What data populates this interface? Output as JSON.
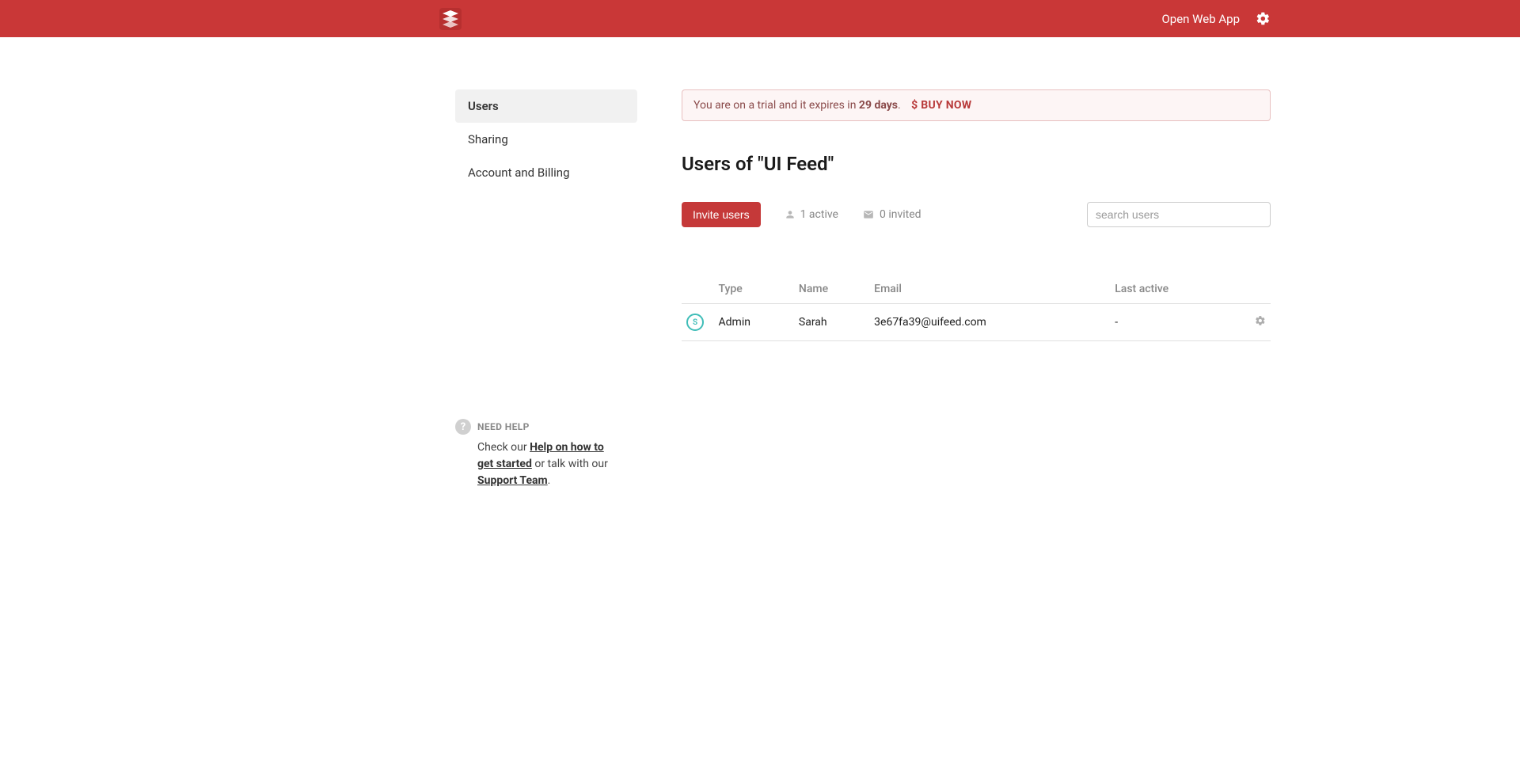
{
  "header": {
    "open_web_app": "Open Web App"
  },
  "sidebar": {
    "items": [
      {
        "label": "Users",
        "active": true
      },
      {
        "label": "Sharing",
        "active": false
      },
      {
        "label": "Account and Billing",
        "active": false
      }
    ]
  },
  "help": {
    "title": "NEED HELP",
    "check_our": "Check our ",
    "help_link": "Help on how to get started",
    "or_talk": " or talk with our ",
    "support_link": "Support Team",
    "period": "."
  },
  "trial": {
    "prefix": "You are on a trial and it expires in ",
    "days": "29 days",
    "period": ".",
    "dollar": "$",
    "buy_now": "BUY NOW"
  },
  "page_title": "Users of \"UI Feed\"",
  "toolbar": {
    "invite_label": "Invite users",
    "active_count": "1 active",
    "invited_count": "0 invited",
    "search_placeholder": "search users"
  },
  "table": {
    "headers": {
      "type": "Type",
      "name": "Name",
      "email": "Email",
      "last_active": "Last active"
    },
    "rows": [
      {
        "avatar_initial": "S",
        "type": "Admin",
        "name": "Sarah",
        "email": "3e67fa39@uifeed.com",
        "last_active": "-"
      }
    ]
  }
}
